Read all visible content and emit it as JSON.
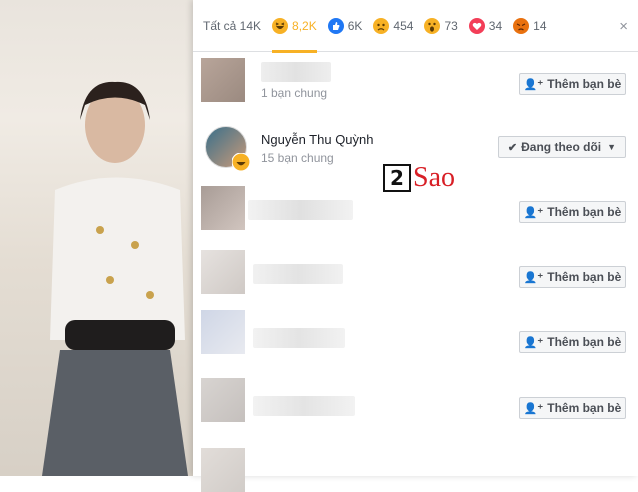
{
  "reactions_tabs": [
    {
      "label": "Tất cả 14K",
      "icon": "none"
    },
    {
      "label": "8,2K",
      "icon": "haha-reaction-icon",
      "color": "#f7b125"
    },
    {
      "label": "6K",
      "icon": "like-reaction-icon",
      "color": "#2078f4"
    },
    {
      "label": "454",
      "icon": "sad-reaction-icon",
      "color": "#f7b125"
    },
    {
      "label": "73",
      "icon": "wow-reaction-icon",
      "color": "#f7b125"
    },
    {
      "label": "34",
      "icon": "love-reaction-icon",
      "color": "#f33e58"
    },
    {
      "label": "14",
      "icon": "angry-reaction-icon",
      "color": "#e9710f"
    }
  ],
  "close_icon": "×",
  "rows": [
    {
      "name": "",
      "mutual": "1 bạn chung",
      "button": "Thêm bạn bè"
    },
    {
      "name": "Nguyễn Thu Quỳnh",
      "mutual": "15 bạn chung",
      "button": "Đang theo dõi"
    },
    {
      "name": "",
      "mutual": "",
      "button": "Thêm bạn bè"
    },
    {
      "name": "",
      "mutual": "",
      "button": "Thêm bạn bè"
    },
    {
      "name": "",
      "mutual": "",
      "button": "Thêm bạn bè"
    },
    {
      "name": "",
      "mutual": "",
      "button": "Thêm bạn bè"
    }
  ],
  "watermark": {
    "box": "2",
    "text": "Sao"
  }
}
